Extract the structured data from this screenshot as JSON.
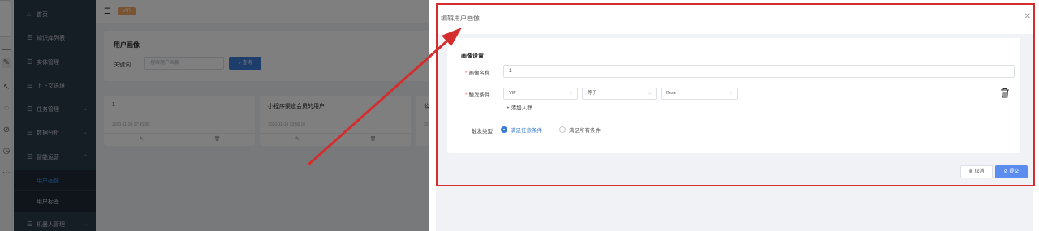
{
  "sidebar": {
    "items": [
      {
        "label": "首页",
        "icon": "home-icon"
      },
      {
        "label": "知识库列表",
        "icon": "doc-icon"
      },
      {
        "label": "实体管理",
        "icon": "doc-icon"
      },
      {
        "label": "上下文语境",
        "icon": "doc-icon"
      },
      {
        "label": "任务管理",
        "icon": "doc-icon"
      },
      {
        "label": "数据分析",
        "icon": "doc-icon"
      },
      {
        "label": "智能运营",
        "icon": "doc-icon"
      },
      {
        "label": "机器人管理",
        "icon": "doc-icon"
      }
    ],
    "submenu": [
      {
        "label": "用户画像",
        "active": true
      },
      {
        "label": "用户标签",
        "active": false
      }
    ]
  },
  "topbar": {
    "tag": "VIP"
  },
  "search": {
    "title": "用户画像",
    "keyword_label": "关键词",
    "keyword_placeholder": "搜索用户画像",
    "query_button": "查询"
  },
  "cards": [
    {
      "name": "1",
      "time": "2020-11-10 17:45:08"
    },
    {
      "name": "小程序渠道会员的用户",
      "time": "2020-11-14 13:56:10"
    },
    {
      "name": "公",
      "time": "20"
    }
  ],
  "drawer": {
    "title": "编辑用户画像",
    "section_title": "画像设置",
    "name_label": "画像名称",
    "name_value": "1",
    "condition_label": "触发条件",
    "condition_field": "VIP",
    "condition_op": "等于",
    "condition_value": "ffese",
    "add_group": "添加人群",
    "trigger_type_label": "触发类型",
    "trigger_any": "满足任意条件",
    "trigger_all": "满足所有条件",
    "cancel_button": "取消",
    "submit_button": "提交"
  },
  "colors": {
    "accent": "#3a7bd5",
    "annotation": "#d32d2d",
    "sidebar": "#2b3a4b"
  }
}
